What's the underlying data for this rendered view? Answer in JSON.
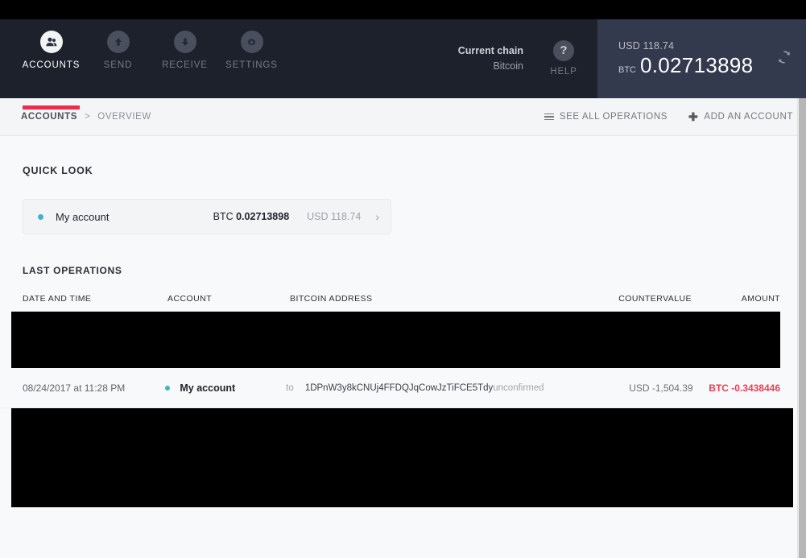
{
  "nav": {
    "items": [
      {
        "label": "ACCOUNTS",
        "icon": "accounts-icon",
        "active": true
      },
      {
        "label": "SEND",
        "icon": "send-up-arrow-icon",
        "active": false
      },
      {
        "label": "RECEIVE",
        "icon": "receive-down-arrow-icon",
        "active": false
      },
      {
        "label": "SETTINGS",
        "icon": "gear-icon",
        "active": false
      }
    ],
    "active_underline_color": "#EA2E49"
  },
  "chain": {
    "title": "Current chain",
    "value": "Bitcoin"
  },
  "help": {
    "label": "HELP",
    "glyph": "?"
  },
  "balance": {
    "usd": "USD 118.74",
    "unit": "BTC",
    "amount": "0.02713898",
    "refresh_icon": "refresh-icon"
  },
  "breadcrumb": {
    "root": "ACCOUNTS",
    "separator": ">",
    "current": "OVERVIEW"
  },
  "crumb_actions": {
    "see_all": "SEE ALL OPERATIONS",
    "add_account": "ADD AN ACCOUNT"
  },
  "quick_look": {
    "title": "QUICK LOOK",
    "account": {
      "name": "My account",
      "status_color": "#41B4C4",
      "btc_label": "BTC",
      "btc_value": "0.02713898",
      "usd": "USD 118.74",
      "chevron": "›"
    }
  },
  "operations": {
    "title": "LAST OPERATIONS",
    "columns": {
      "date": "DATE AND TIME",
      "account": "ACCOUNT",
      "address": "BITCOIN ADDRESS",
      "countervalue": "COUNTERVALUE",
      "amount": "AMOUNT"
    },
    "rows": [
      {
        "date": "08/24/2017 at 11:28 PM",
        "account": "My account",
        "direction": "to",
        "address": "1DPnW3y8kCNUj4FFDQJqCowJzTiFCE5Tdy",
        "status": "unconfirmed",
        "countervalue": "USD -1,504.39",
        "amount": "BTC -0.3438446",
        "amount_color": "#EE3B55",
        "status_color": "#41B4C4"
      }
    ]
  }
}
